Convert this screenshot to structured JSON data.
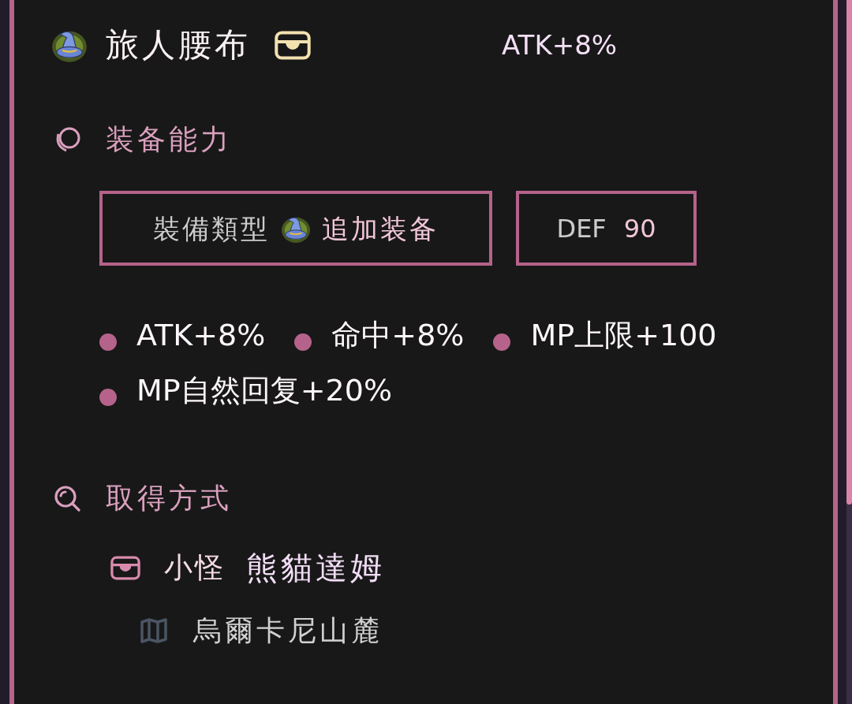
{
  "item": {
    "name": "旅人腰布",
    "stat": "ATK+8%"
  },
  "abilities": {
    "title": "装备能力",
    "equip_type": {
      "label": "裝備類型",
      "value": "追加装备"
    },
    "defense": {
      "label": "DEF",
      "value": "90"
    },
    "effects": [
      "ATK+8%",
      "命中+8%",
      "MP上限+100",
      "MP自然回复+20%"
    ]
  },
  "acquisition": {
    "title": "取得方式",
    "sources": [
      {
        "type": "小怪",
        "name": "熊貓達姆",
        "location": "烏爾卡尼山麓"
      }
    ]
  }
}
